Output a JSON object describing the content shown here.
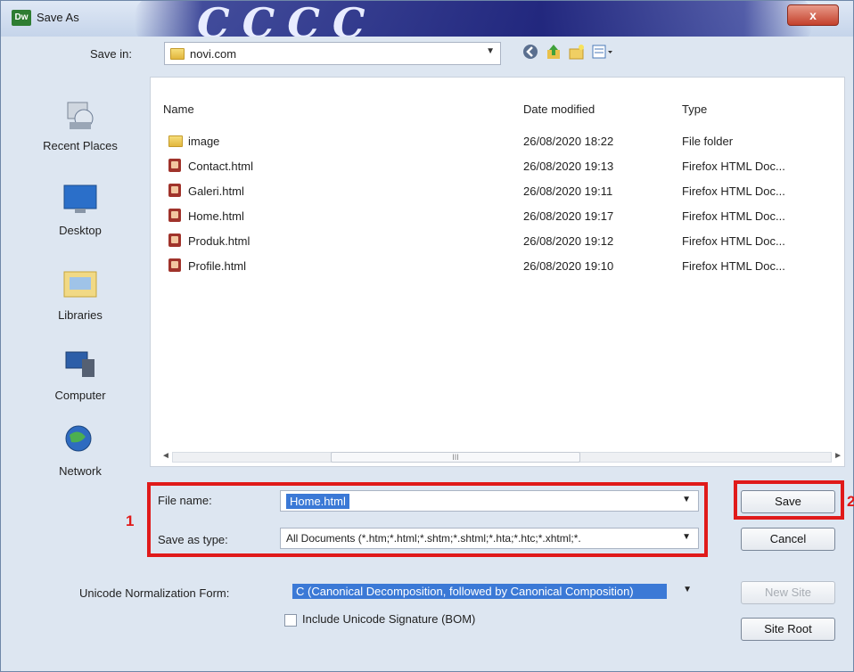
{
  "window": {
    "title": "Save As",
    "app_icon_text": "Dw",
    "close_symbol": "x",
    "title_art_text": "CCCC"
  },
  "save_in": {
    "label": "Save in:",
    "value": "novi.com"
  },
  "toolbar": {
    "icons": [
      "back-icon",
      "up-folder-icon",
      "new-folder-icon",
      "views-menu-icon"
    ]
  },
  "places": [
    {
      "label": "Recent Places",
      "icon": "recent-places-icon"
    },
    {
      "label": "Desktop",
      "icon": "desktop-icon"
    },
    {
      "label": "Libraries",
      "icon": "libraries-icon"
    },
    {
      "label": "Computer",
      "icon": "computer-icon"
    },
    {
      "label": "Network",
      "icon": "network-icon"
    }
  ],
  "file_list": {
    "columns": [
      "Name",
      "Date modified",
      "Type"
    ],
    "rows": [
      {
        "name": "image",
        "date": "26/08/2020 18:22",
        "type": "File folder",
        "icon": "folder-icon"
      },
      {
        "name": "Contact.html",
        "date": "26/08/2020 19:13",
        "type": "Firefox HTML Doc...",
        "icon": "html-file-icon"
      },
      {
        "name": "Galeri.html",
        "date": "26/08/2020 19:11",
        "type": "Firefox HTML Doc...",
        "icon": "html-file-icon"
      },
      {
        "name": "Home.html",
        "date": "26/08/2020 19:17",
        "type": "Firefox HTML Doc...",
        "icon": "html-file-icon"
      },
      {
        "name": "Produk.html",
        "date": "26/08/2020 19:12",
        "type": "Firefox HTML Doc...",
        "icon": "html-file-icon"
      },
      {
        "name": "Profile.html",
        "date": "26/08/2020 19:10",
        "type": "Firefox HTML Doc...",
        "icon": "html-file-icon"
      }
    ]
  },
  "scrollbar": {
    "thumb_grip": "III"
  },
  "form": {
    "file_name_label": "File name:",
    "file_name_value": "Home.html",
    "save_as_type_label": "Save as type:",
    "save_as_type_value": "All Documents (*.htm;*.html;*.shtm;*.shtml;*.hta;*.htc;*.xhtml;*.",
    "unicode_label": "Unicode Normalization Form:",
    "unicode_value": "C (Canonical Decomposition, followed by Canonical Composition)",
    "bom_label": "Include Unicode Signature (BOM)"
  },
  "buttons": {
    "save": "Save",
    "cancel": "Cancel",
    "new_site": "New Site",
    "site_root": "Site Root"
  },
  "annotations": {
    "marker_1": "1",
    "marker_2": "2",
    "highlight_color": "#e01a1a"
  }
}
